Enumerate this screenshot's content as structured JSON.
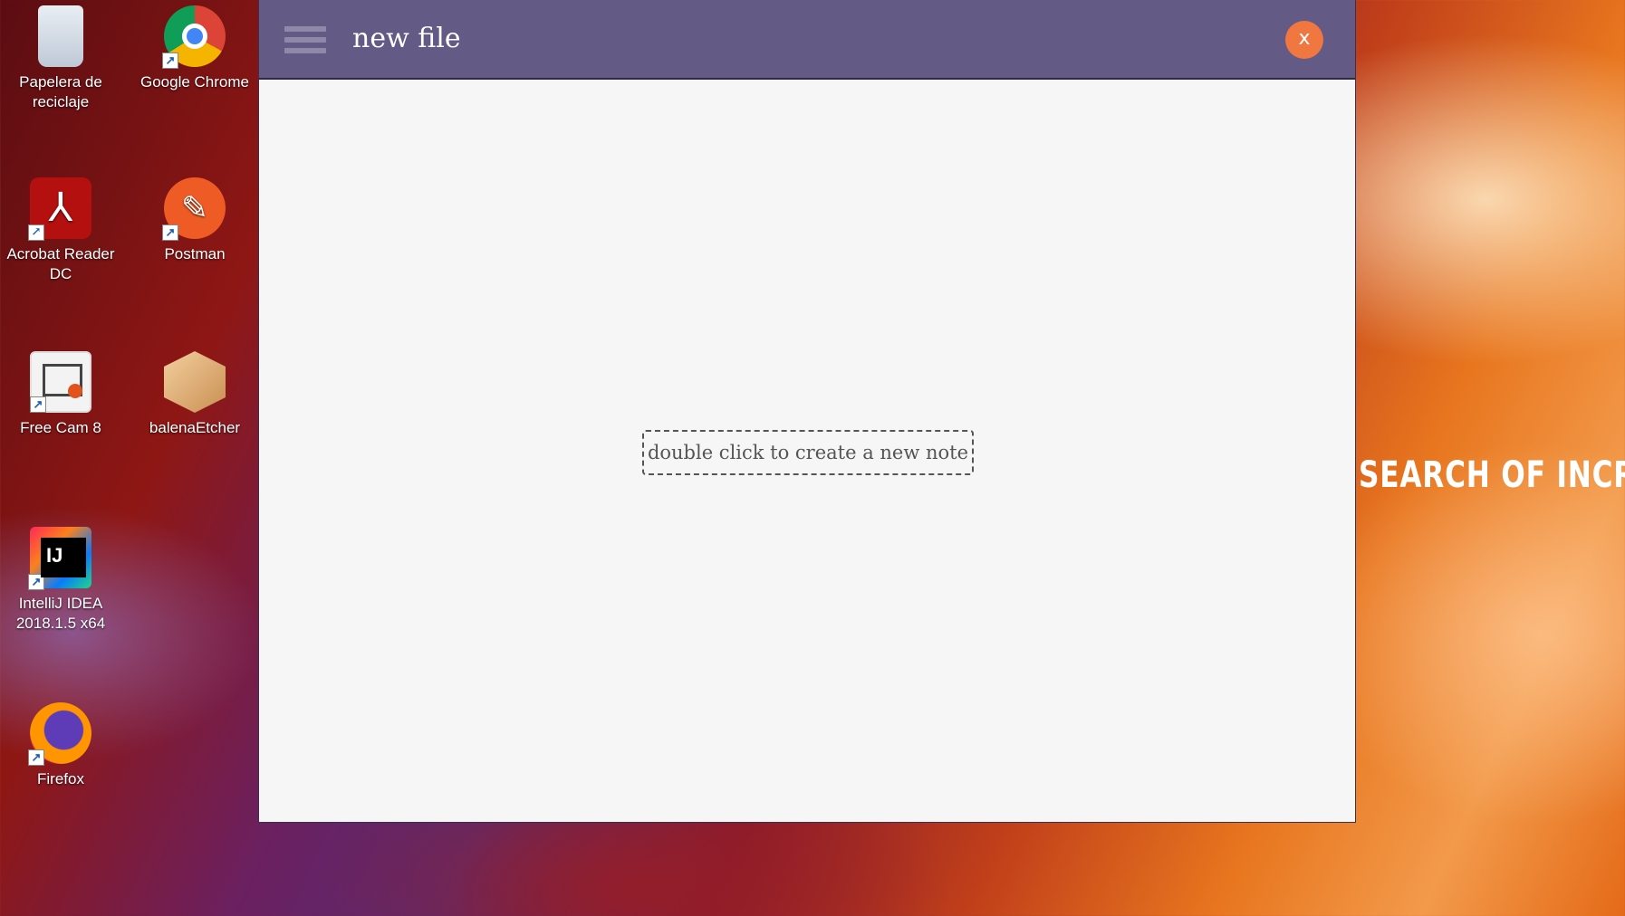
{
  "desktop": {
    "icons": [
      {
        "label_line1": "Papelera de",
        "label_line2": "reciclaje",
        "icon": "recycle-bin-icon"
      },
      {
        "label_line1": "Google Chrome",
        "label_line2": "",
        "icon": "chrome-icon"
      },
      {
        "label_line1": "Acrobat Reader",
        "label_line2": "DC",
        "icon": "acrobat-icon"
      },
      {
        "label_line1": "Postman",
        "label_line2": "",
        "icon": "postman-icon"
      },
      {
        "label_line1": "Free Cam 8",
        "label_line2": "",
        "icon": "freecam-icon"
      },
      {
        "label_line1": "balenaEtcher",
        "label_line2": "",
        "icon": "etcher-icon"
      },
      {
        "label_line1": "IntelliJ IDEA",
        "label_line2": "2018.1.5 x64",
        "icon": "intellij-icon"
      },
      {
        "label_line1": "Firefox",
        "label_line2": "",
        "icon": "firefox-icon"
      }
    ],
    "wallpaper_text": "SEARCH OF INCRED"
  },
  "app": {
    "title": "new file",
    "close_label": "x",
    "hint": "double click to create a new note",
    "colors": {
      "titlebar": "#635a86",
      "close": "#f0773f",
      "content_bg": "#f6f6f6"
    }
  }
}
